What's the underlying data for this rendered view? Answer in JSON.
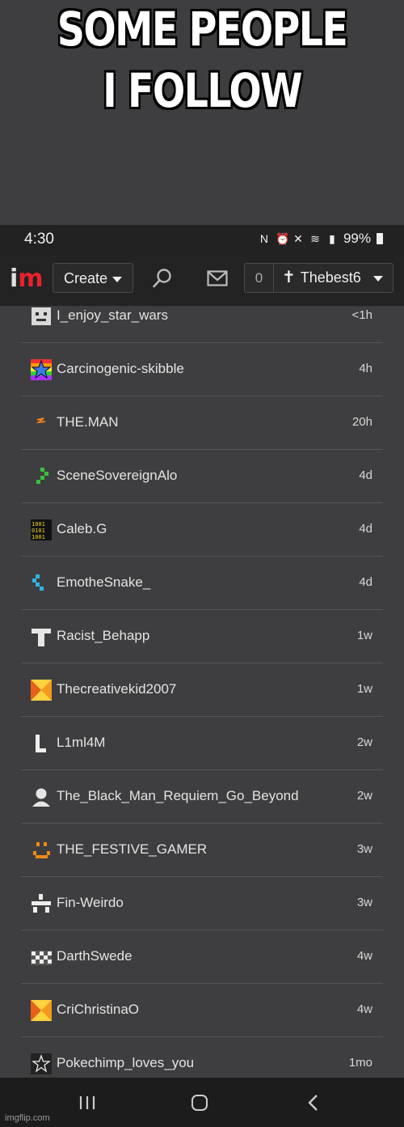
{
  "meme": {
    "line1": "SOME PEOPLE",
    "line2": "I FOLLOW"
  },
  "status_bar": {
    "time": "4:30",
    "battery": "99%"
  },
  "navbar": {
    "logo_i": "i",
    "logo_m": "m",
    "create_label": "Create",
    "notification_count": "0",
    "username": "Thebest6"
  },
  "following": [
    {
      "name": "I_enjoy_star_wars",
      "time": "<1h",
      "avatar_icon": "robot-face-icon",
      "color": "#d9d9d9"
    },
    {
      "name": "Carcinogenic-skibble",
      "time": "4h",
      "avatar_icon": "rainbow-star-icon",
      "color": "#3b7de8"
    },
    {
      "name": "THE.MAN",
      "time": "20h",
      "avatar_icon": "orange-squiggle-icon",
      "color": "#e8801f"
    },
    {
      "name": "SceneSovereignAlo",
      "time": "4d",
      "avatar_icon": "green-pixel-icon",
      "color": "#39c13a"
    },
    {
      "name": "Caleb.G",
      "time": "4d",
      "avatar_icon": "binary-code-icon",
      "color": "#f2d21b"
    },
    {
      "name": "EmotheSnake_",
      "time": "4d",
      "avatar_icon": "blue-pixel-snake-icon",
      "color": "#2fb5e8"
    },
    {
      "name": "Racist_Behapp",
      "time": "1w",
      "avatar_icon": "white-shirt-icon",
      "color": "#e6e6e6"
    },
    {
      "name": "Thecreativekid2007",
      "time": "1w",
      "avatar_icon": "orange-pinwheel-icon",
      "color": "#f29a1b"
    },
    {
      "name": "L1ml4M",
      "time": "2w",
      "avatar_icon": "letter-l-icon",
      "color": "#eeeeee"
    },
    {
      "name": "The_Black_Man_Requiem_Go_Beyond",
      "time": "2w",
      "avatar_icon": "person-silhouette-icon",
      "color": "#e6e6e6"
    },
    {
      "name": "THE_FESTIVE_GAMER",
      "time": "3w",
      "avatar_icon": "orange-smiley-icon",
      "color": "#f08a14"
    },
    {
      "name": "Fin-Weirdo",
      "time": "3w",
      "avatar_icon": "white-blocks-icon",
      "color": "#eeeeee"
    },
    {
      "name": "DarthSwede",
      "time": "4w",
      "avatar_icon": "checker-pattern-icon",
      "color": "#eeeeee"
    },
    {
      "name": "CriChristinaO",
      "time": "4w",
      "avatar_icon": "orange-pinwheel-icon",
      "color": "#f29a1b"
    },
    {
      "name": "Pokechimp_loves_you",
      "time": "1mo",
      "avatar_icon": "outline-star-icon",
      "color": "#eeeeee"
    }
  ],
  "watermark": "imgflip.com"
}
